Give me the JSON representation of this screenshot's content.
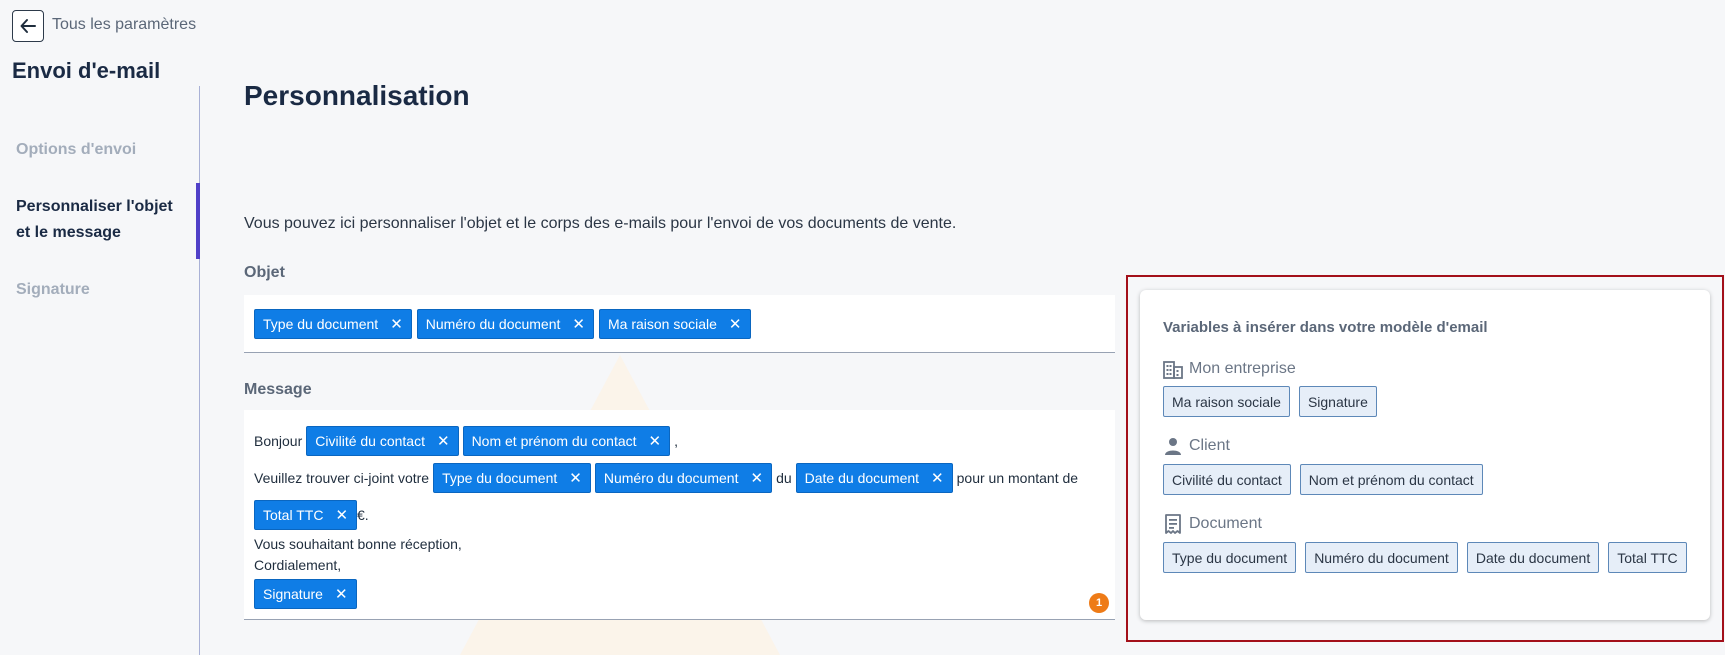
{
  "header": {
    "back_label": "Tous les paramètres",
    "section_title": "Envoi d'e-mail"
  },
  "sidebar": {
    "items": [
      {
        "label": "Options d'envoi"
      },
      {
        "label_line1": "Personnaliser l'objet",
        "label_line2": "et le message"
      },
      {
        "label": "Signature"
      }
    ]
  },
  "main": {
    "title": "Personnalisation",
    "intro": "Vous pouvez ici personnaliser l'objet et le corps des e-mails pour l'envoi de vos documents de vente.",
    "subject": {
      "label": "Objet",
      "chips": [
        "Type du document",
        "Numéro du document",
        "Ma raison sociale"
      ]
    },
    "message": {
      "label": "Message",
      "line1_text": "Bonjour",
      "line1_chips": [
        "Civilité du contact",
        "Nom et prénom du contact"
      ],
      "line1_end": ",",
      "line2_text": "Veuillez trouver ci-joint votre",
      "line2_chips": [
        "Type du document",
        "Numéro du document",
        "Date du document"
      ],
      "line2_du": "du",
      "line2_end": "pour un montant de",
      "line3_chip": "Total TTC",
      "line3_end": "€.",
      "line4": "Vous souhaitant bonne réception,",
      "line5": "Cordialement,",
      "signature_chip": "Signature",
      "badge_count": "1"
    },
    "chip_remove_glyph": "✕"
  },
  "variables_panel": {
    "title": "Variables à insérer dans votre modèle d'email",
    "groups": [
      {
        "name": "Mon entreprise",
        "icon": "building-icon",
        "items": [
          "Ma raison sociale",
          "Signature"
        ]
      },
      {
        "name": "Client",
        "icon": "person-icon",
        "items": [
          "Civilité du contact",
          "Nom et prénom du contact"
        ]
      },
      {
        "name": "Document",
        "icon": "receipt-icon",
        "items": [
          "Type du document",
          "Numéro du document",
          "Date du document",
          "Total TTC"
        ]
      }
    ]
  },
  "colors": {
    "chip_blue": "#0f7de6",
    "active_bar": "#5040c8",
    "highlight_frame": "#a3101a",
    "badge_orange": "#ee7b17"
  }
}
